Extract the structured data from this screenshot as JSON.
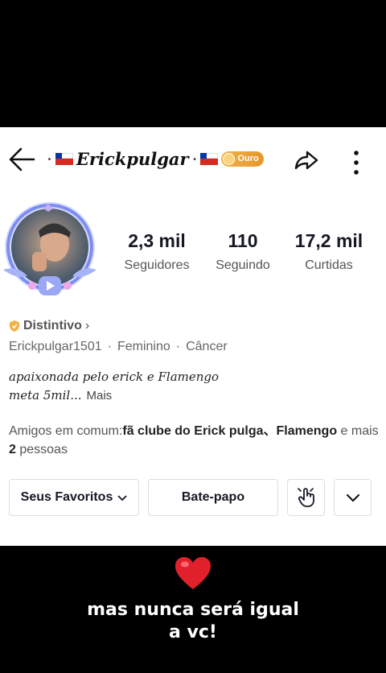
{
  "header": {
    "star_left": "⋆",
    "username_display": "Erickpulgar",
    "star_right": "⋆",
    "badge_label": "Ouro"
  },
  "stats": [
    {
      "value": "2,3 mil",
      "label": "Seguidores"
    },
    {
      "value": "110",
      "label": "Seguindo"
    },
    {
      "value": "17,2 mil",
      "label": "Curtidas"
    }
  ],
  "profile": {
    "distintivo_label": "Distintivo",
    "distintivo_chevron": "›",
    "handle": "Erickpulgar1501",
    "gender": "Feminino",
    "sign": "Câncer",
    "separator": "·",
    "bio_line1": "apaixonada pelo erick e Flamengo",
    "bio_line2": "meta 5mil...",
    "bio_more": "Mais",
    "mutual_prefix": "Amigos em comum:",
    "mutual_names": "fã clube do Erick pulga、Flamengo",
    "mutual_and": " e mais ",
    "mutual_count": "2",
    "mutual_suffix": " pessoas"
  },
  "actions": {
    "favorites_label": "Seus Favoritos",
    "chat_label": "Bate-papo"
  },
  "overlay": {
    "caption_line1": "mas nunca será igual",
    "caption_line2": "a vc!"
  },
  "colors": {
    "badge_gold": "#e6952a",
    "flag_red": "#d52b1e",
    "flag_blue": "#0039a6",
    "heart": "#e0202a"
  }
}
